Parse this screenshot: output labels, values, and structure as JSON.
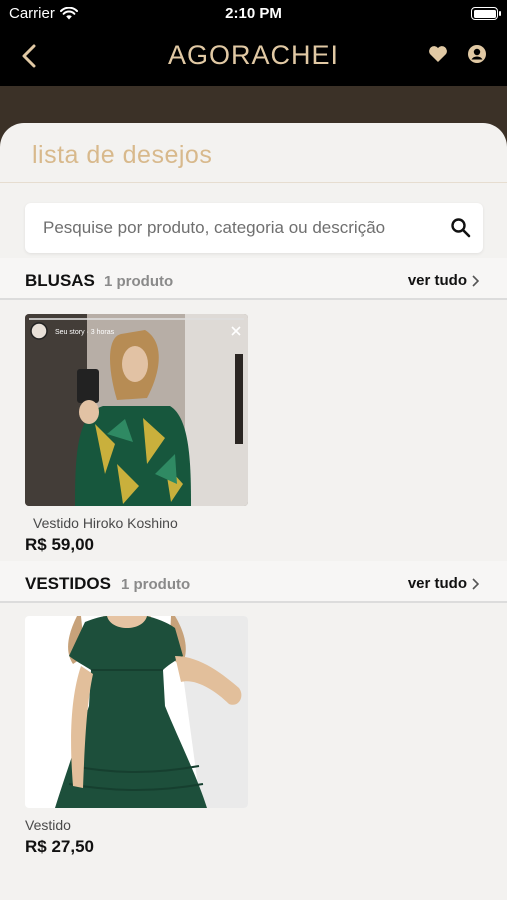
{
  "status_bar": {
    "carrier": "Carrier",
    "time": "2:10 PM"
  },
  "nav": {
    "logo_part1": "AGORA",
    "logo_part2": "CHEI"
  },
  "page": {
    "title": "lista de desejos"
  },
  "search": {
    "placeholder": "Pesquise por produto, categoria ou descrição"
  },
  "sections": [
    {
      "name": "BLUSAS",
      "count": "1 produto",
      "see_all": "ver tudo",
      "product": {
        "name": "Vestido Hiroko Koshino",
        "price": "R$ 59,00",
        "image_overlay": "Seu story · 3 horas"
      }
    },
    {
      "name": "VESTIDOS",
      "count": "1 produto",
      "see_all": "ver tudo",
      "product": {
        "name": "Vestido",
        "price": "R$ 27,50"
      }
    }
  ],
  "colors": {
    "accent_gold": "#d8b98c",
    "nav_black": "#000000",
    "sheet_bg": "#f3f2f0"
  }
}
